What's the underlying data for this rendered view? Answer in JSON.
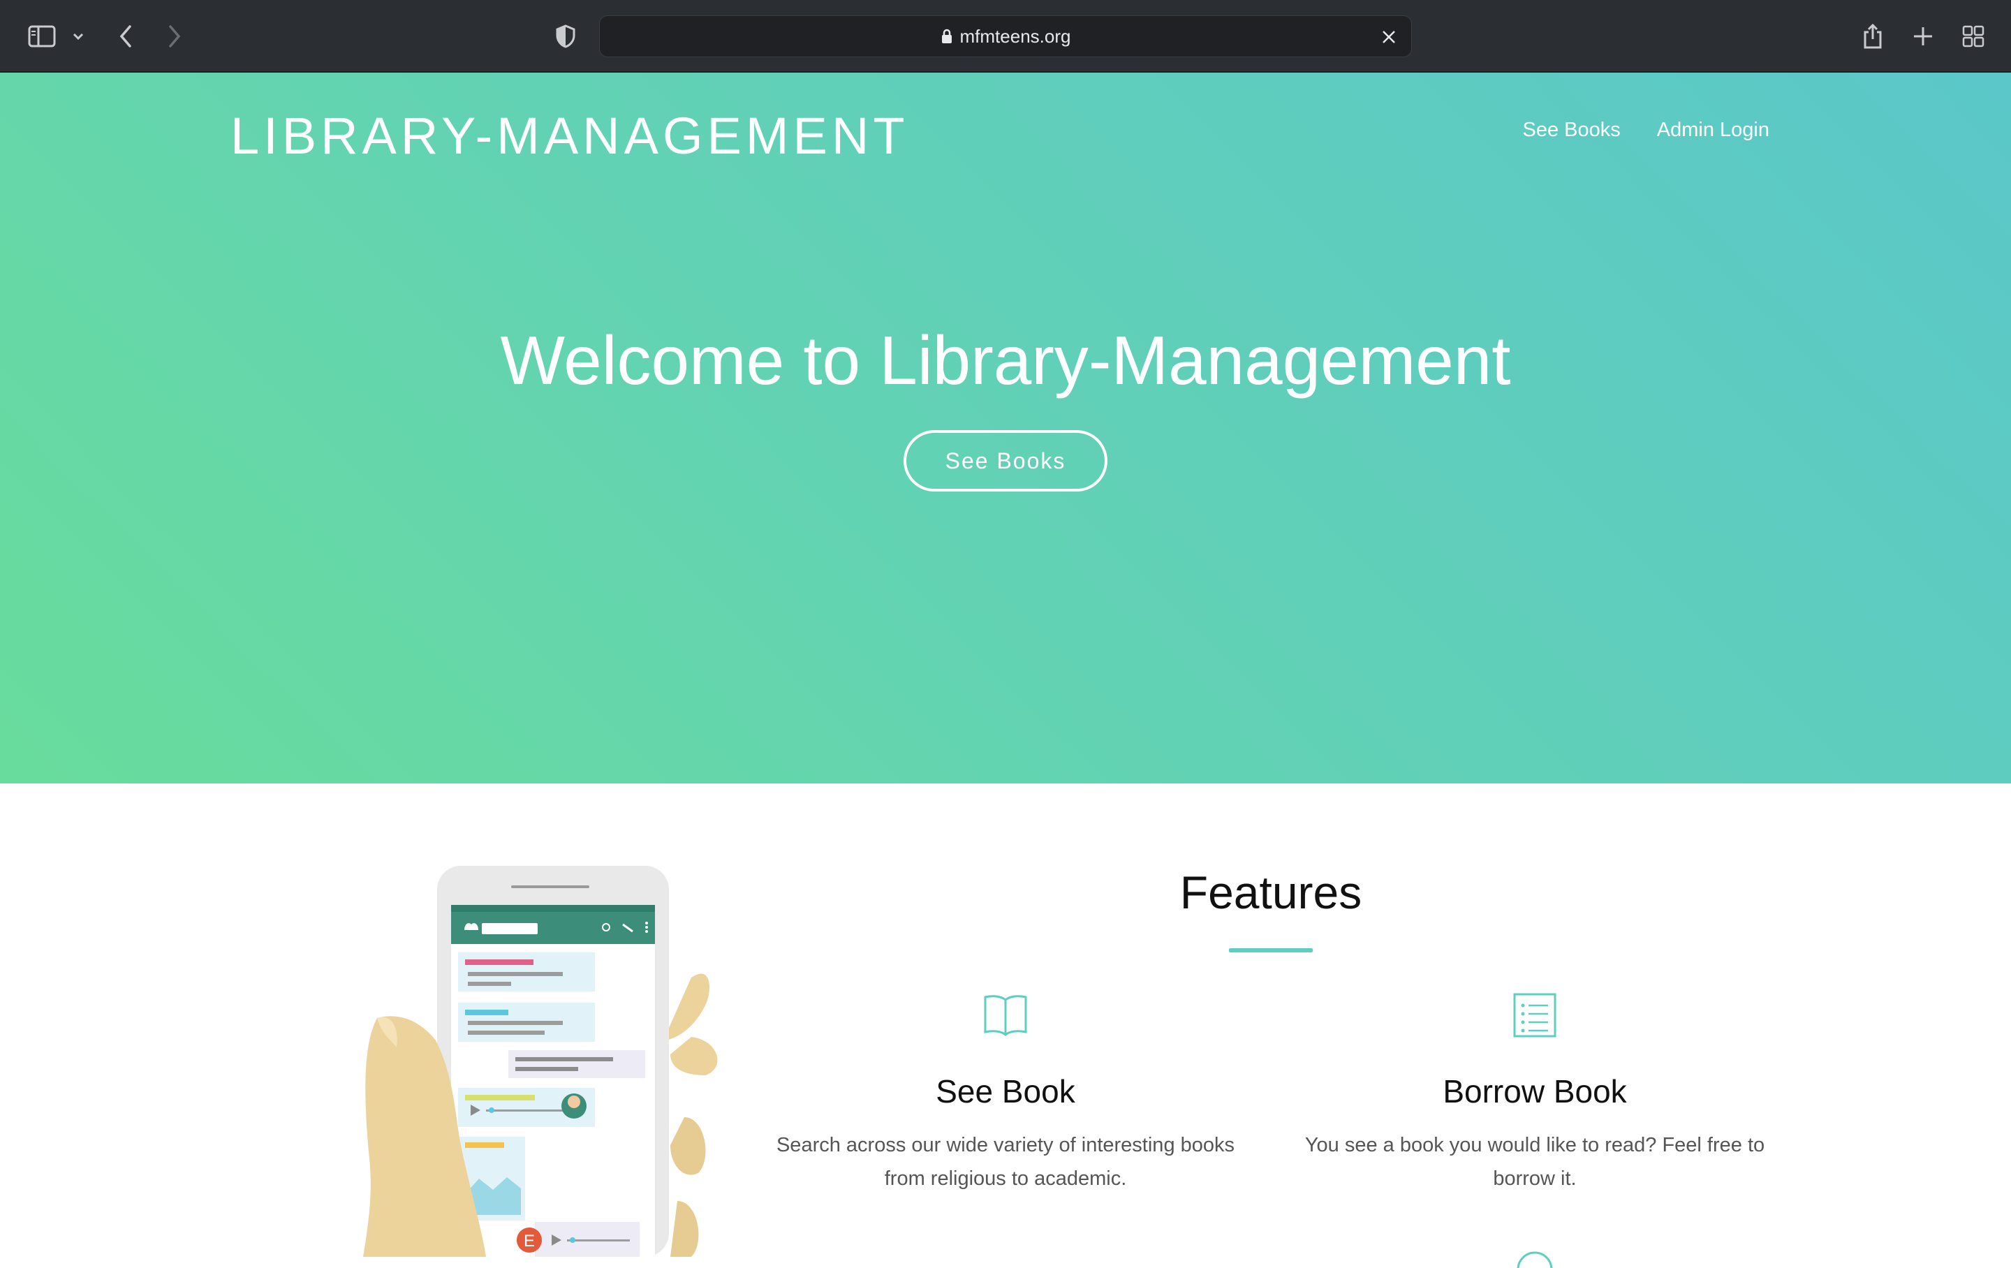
{
  "browser": {
    "url": "mfmteens.org"
  },
  "site": {
    "brand": "LIBRARY-MANAGEMENT",
    "nav": {
      "see_books": "See Books",
      "admin_login": "Admin Login"
    }
  },
  "hero": {
    "title": "Welcome to Library-Management",
    "button_label": "See Books"
  },
  "features": {
    "title": "Features",
    "items": [
      {
        "icon": "open-book-icon",
        "title": "See Book",
        "text": "Search across our wide variety of interesting books from religious to academic."
      },
      {
        "icon": "list-icon",
        "title": "Borrow Book",
        "text": "You see a book you would like to read? Feel free to borrow it."
      }
    ]
  },
  "colors": {
    "hero_gradient_start": "#68dc9c",
    "hero_gradient_end": "#5bc7c9",
    "accent": "#5ccfc0",
    "chrome": "#2b2e33"
  },
  "illustration": {
    "avatar_letter": "E"
  }
}
